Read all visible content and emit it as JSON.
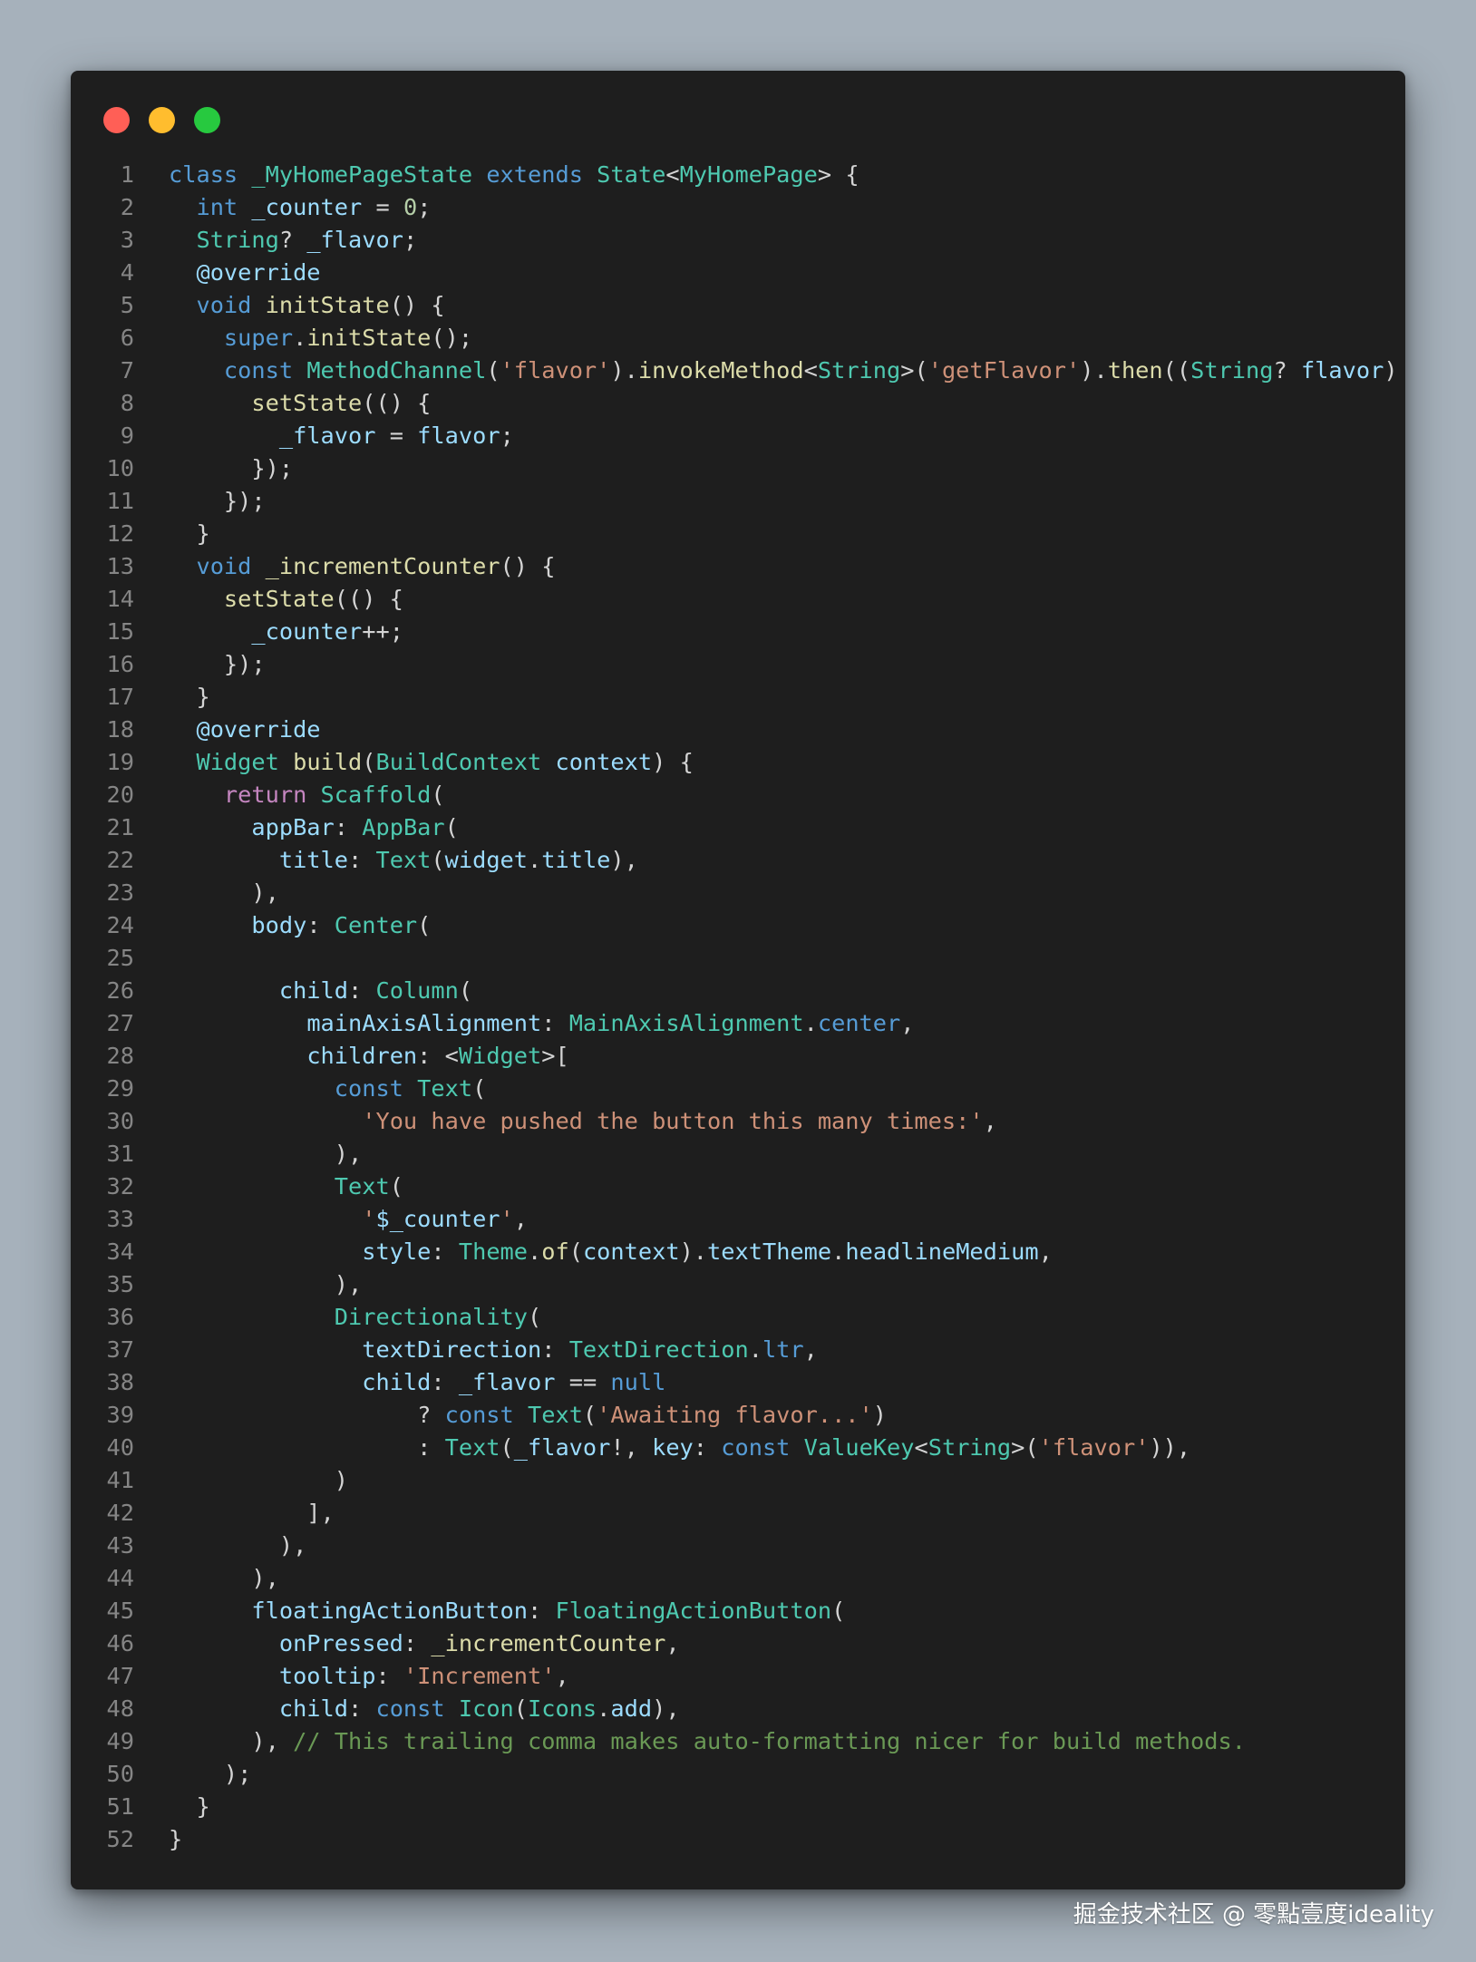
{
  "window": {
    "controls": [
      {
        "name": "close",
        "color": "#ff5f56"
      },
      {
        "name": "minimize",
        "color": "#ffbd2e"
      },
      {
        "name": "maximize",
        "color": "#27c93f"
      }
    ]
  },
  "code": {
    "lines": [
      [
        [
          "kw",
          "class"
        ],
        [
          "p",
          " "
        ],
        [
          "type",
          "_MyHomePageState"
        ],
        [
          "p",
          " "
        ],
        [
          "kw",
          "extends"
        ],
        [
          "p",
          " "
        ],
        [
          "type",
          "State"
        ],
        [
          "p",
          "<"
        ],
        [
          "type",
          "MyHomePage"
        ],
        [
          "p",
          "> {"
        ]
      ],
      [
        [
          "p",
          "  "
        ],
        [
          "kw",
          "int"
        ],
        [
          "p",
          " "
        ],
        [
          "var",
          "_counter"
        ],
        [
          "p",
          " = "
        ],
        [
          "num",
          "0"
        ],
        [
          "p",
          ";"
        ]
      ],
      [
        [
          "p",
          "  "
        ],
        [
          "type",
          "String"
        ],
        [
          "p",
          "? "
        ],
        [
          "var",
          "_flavor"
        ],
        [
          "p",
          ";"
        ]
      ],
      [
        [
          "p",
          "  "
        ],
        [
          "var",
          "@override"
        ]
      ],
      [
        [
          "p",
          "  "
        ],
        [
          "kw",
          "void"
        ],
        [
          "p",
          " "
        ],
        [
          "fn",
          "initState"
        ],
        [
          "p",
          "() {"
        ]
      ],
      [
        [
          "p",
          "    "
        ],
        [
          "kw",
          "super"
        ],
        [
          "p",
          "."
        ],
        [
          "fn",
          "initState"
        ],
        [
          "p",
          "();"
        ]
      ],
      [
        [
          "p",
          "    "
        ],
        [
          "kw",
          "const"
        ],
        [
          "p",
          " "
        ],
        [
          "type",
          "MethodChannel"
        ],
        [
          "p",
          "("
        ],
        [
          "str",
          "'flavor'"
        ],
        [
          "p",
          ")."
        ],
        [
          "fn",
          "invokeMethod"
        ],
        [
          "p",
          "<"
        ],
        [
          "type",
          "String"
        ],
        [
          "p",
          ">("
        ],
        [
          "str",
          "'getFlavor'"
        ],
        [
          "p",
          ")."
        ],
        [
          "fn",
          "then"
        ],
        [
          "p",
          "(("
        ],
        [
          "type",
          "String"
        ],
        [
          "p",
          "? "
        ],
        [
          "var",
          "flavor"
        ],
        [
          "p",
          ") {"
        ]
      ],
      [
        [
          "p",
          "      "
        ],
        [
          "fn",
          "setState"
        ],
        [
          "p",
          "(() {"
        ]
      ],
      [
        [
          "p",
          "        "
        ],
        [
          "var",
          "_flavor"
        ],
        [
          "p",
          " = "
        ],
        [
          "var",
          "flavor"
        ],
        [
          "p",
          ";"
        ]
      ],
      [
        [
          "p",
          "      });"
        ]
      ],
      [
        [
          "p",
          "    });"
        ]
      ],
      [
        [
          "p",
          "  }"
        ]
      ],
      [
        [
          "p",
          "  "
        ],
        [
          "kw",
          "void"
        ],
        [
          "p",
          " "
        ],
        [
          "fn",
          "_incrementCounter"
        ],
        [
          "p",
          "() {"
        ]
      ],
      [
        [
          "p",
          "    "
        ],
        [
          "fn",
          "setState"
        ],
        [
          "p",
          "(() {"
        ]
      ],
      [
        [
          "p",
          "      "
        ],
        [
          "var",
          "_counter"
        ],
        [
          "p",
          "++;"
        ]
      ],
      [
        [
          "p",
          "    });"
        ]
      ],
      [
        [
          "p",
          "  }"
        ]
      ],
      [
        [
          "p",
          "  "
        ],
        [
          "var",
          "@override"
        ]
      ],
      [
        [
          "p",
          "  "
        ],
        [
          "type",
          "Widget"
        ],
        [
          "p",
          " "
        ],
        [
          "fn",
          "build"
        ],
        [
          "p",
          "("
        ],
        [
          "type",
          "BuildContext"
        ],
        [
          "p",
          " "
        ],
        [
          "var",
          "context"
        ],
        [
          "p",
          ") {"
        ]
      ],
      [
        [
          "p",
          "    "
        ],
        [
          "ctrl",
          "return"
        ],
        [
          "p",
          " "
        ],
        [
          "type",
          "Scaffold"
        ],
        [
          "p",
          "("
        ]
      ],
      [
        [
          "p",
          "      "
        ],
        [
          "var",
          "appBar"
        ],
        [
          "p",
          ": "
        ],
        [
          "type",
          "AppBar"
        ],
        [
          "p",
          "("
        ]
      ],
      [
        [
          "p",
          "        "
        ],
        [
          "var",
          "title"
        ],
        [
          "p",
          ": "
        ],
        [
          "type",
          "Text"
        ],
        [
          "p",
          "("
        ],
        [
          "var",
          "widget"
        ],
        [
          "p",
          "."
        ],
        [
          "var",
          "title"
        ],
        [
          "p",
          "),"
        ]
      ],
      [
        [
          "p",
          "      ),"
        ]
      ],
      [
        [
          "p",
          "      "
        ],
        [
          "var",
          "body"
        ],
        [
          "p",
          ": "
        ],
        [
          "type",
          "Center"
        ],
        [
          "p",
          "("
        ]
      ],
      [
        [
          "p",
          ""
        ]
      ],
      [
        [
          "p",
          "        "
        ],
        [
          "var",
          "child"
        ],
        [
          "p",
          ": "
        ],
        [
          "type",
          "Column"
        ],
        [
          "p",
          "("
        ]
      ],
      [
        [
          "p",
          "          "
        ],
        [
          "var",
          "mainAxisAlignment"
        ],
        [
          "p",
          ": "
        ],
        [
          "type",
          "MainAxisAlignment"
        ],
        [
          "p",
          "."
        ],
        [
          "kw",
          "center"
        ],
        [
          "p",
          ","
        ]
      ],
      [
        [
          "p",
          "          "
        ],
        [
          "var",
          "children"
        ],
        [
          "p",
          ": <"
        ],
        [
          "type",
          "Widget"
        ],
        [
          "p",
          ">["
        ]
      ],
      [
        [
          "p",
          "            "
        ],
        [
          "kw",
          "const"
        ],
        [
          "p",
          " "
        ],
        [
          "type",
          "Text"
        ],
        [
          "p",
          "("
        ]
      ],
      [
        [
          "p",
          "              "
        ],
        [
          "str",
          "'You have pushed the button this many times:'"
        ],
        [
          "p",
          ","
        ]
      ],
      [
        [
          "p",
          "            ),"
        ]
      ],
      [
        [
          "p",
          "            "
        ],
        [
          "type",
          "Text"
        ],
        [
          "p",
          "("
        ]
      ],
      [
        [
          "p",
          "              "
        ],
        [
          "str",
          "'"
        ],
        [
          "var",
          "$_counter"
        ],
        [
          "str",
          "'"
        ],
        [
          "p",
          ","
        ]
      ],
      [
        [
          "p",
          "              "
        ],
        [
          "var",
          "style"
        ],
        [
          "p",
          ": "
        ],
        [
          "type",
          "Theme"
        ],
        [
          "p",
          "."
        ],
        [
          "fn",
          "of"
        ],
        [
          "p",
          "("
        ],
        [
          "var",
          "context"
        ],
        [
          "p",
          ")."
        ],
        [
          "var",
          "textTheme"
        ],
        [
          "p",
          "."
        ],
        [
          "var",
          "headlineMedium"
        ],
        [
          "p",
          ","
        ]
      ],
      [
        [
          "p",
          "            ),"
        ]
      ],
      [
        [
          "p",
          "            "
        ],
        [
          "type",
          "Directionality"
        ],
        [
          "p",
          "("
        ]
      ],
      [
        [
          "p",
          "              "
        ],
        [
          "var",
          "textDirection"
        ],
        [
          "p",
          ": "
        ],
        [
          "type",
          "TextDirection"
        ],
        [
          "p",
          "."
        ],
        [
          "kw",
          "ltr"
        ],
        [
          "p",
          ","
        ]
      ],
      [
        [
          "p",
          "              "
        ],
        [
          "var",
          "child"
        ],
        [
          "p",
          ": "
        ],
        [
          "var",
          "_flavor"
        ],
        [
          "p",
          " == "
        ],
        [
          "kw",
          "null"
        ]
      ],
      [
        [
          "p",
          "                  ? "
        ],
        [
          "kw",
          "const"
        ],
        [
          "p",
          " "
        ],
        [
          "type",
          "Text"
        ],
        [
          "p",
          "("
        ],
        [
          "str",
          "'Awaiting flavor...'"
        ],
        [
          "p",
          ")"
        ]
      ],
      [
        [
          "p",
          "                  : "
        ],
        [
          "type",
          "Text"
        ],
        [
          "p",
          "("
        ],
        [
          "var",
          "_flavor"
        ],
        [
          "p",
          "!, "
        ],
        [
          "var",
          "key"
        ],
        [
          "p",
          ": "
        ],
        [
          "kw",
          "const"
        ],
        [
          "p",
          " "
        ],
        [
          "type",
          "ValueKey"
        ],
        [
          "p",
          "<"
        ],
        [
          "type",
          "String"
        ],
        [
          "p",
          ">("
        ],
        [
          "str",
          "'flavor'"
        ],
        [
          "p",
          ")),"
        ]
      ],
      [
        [
          "p",
          "            )"
        ]
      ],
      [
        [
          "p",
          "          ],"
        ]
      ],
      [
        [
          "p",
          "        ),"
        ]
      ],
      [
        [
          "p",
          "      ),"
        ]
      ],
      [
        [
          "p",
          "      "
        ],
        [
          "var",
          "floatingActionButton"
        ],
        [
          "p",
          ": "
        ],
        [
          "type",
          "FloatingActionButton"
        ],
        [
          "p",
          "("
        ]
      ],
      [
        [
          "p",
          "        "
        ],
        [
          "var",
          "onPressed"
        ],
        [
          "p",
          ": "
        ],
        [
          "fn",
          "_incrementCounter"
        ],
        [
          "p",
          ","
        ]
      ],
      [
        [
          "p",
          "        "
        ],
        [
          "var",
          "tooltip"
        ],
        [
          "p",
          ": "
        ],
        [
          "str",
          "'Increment'"
        ],
        [
          "p",
          ","
        ]
      ],
      [
        [
          "p",
          "        "
        ],
        [
          "var",
          "child"
        ],
        [
          "p",
          ": "
        ],
        [
          "kw",
          "const"
        ],
        [
          "p",
          " "
        ],
        [
          "type",
          "Icon"
        ],
        [
          "p",
          "("
        ],
        [
          "type",
          "Icons"
        ],
        [
          "p",
          "."
        ],
        [
          "var",
          "add"
        ],
        [
          "p",
          "),"
        ]
      ],
      [
        [
          "p",
          "      ), "
        ],
        [
          "com",
          "// This trailing comma makes auto-formatting nicer for build methods."
        ]
      ],
      [
        [
          "p",
          "    );"
        ]
      ],
      [
        [
          "p",
          "  }"
        ]
      ],
      [
        [
          "p",
          "}"
        ]
      ]
    ]
  },
  "watermark": "掘金技术社区 @ 零點壹度ideality"
}
